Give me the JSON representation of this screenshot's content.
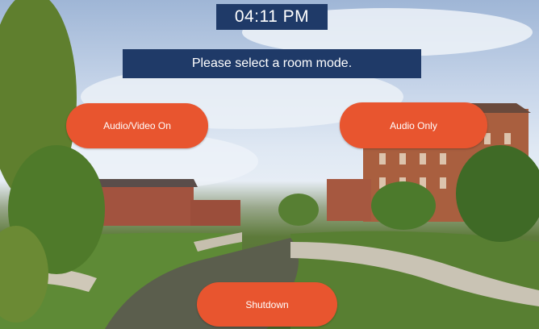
{
  "clock": {
    "time": "04:11 PM"
  },
  "prompt": {
    "text": "Please select a room mode."
  },
  "buttons": {
    "av_on": "Audio/Video On",
    "audio_only": "Audio Only",
    "shutdown": "Shutdown"
  },
  "colors": {
    "panel_navy": "#1f3a68",
    "button_orange": "#e8552f"
  }
}
